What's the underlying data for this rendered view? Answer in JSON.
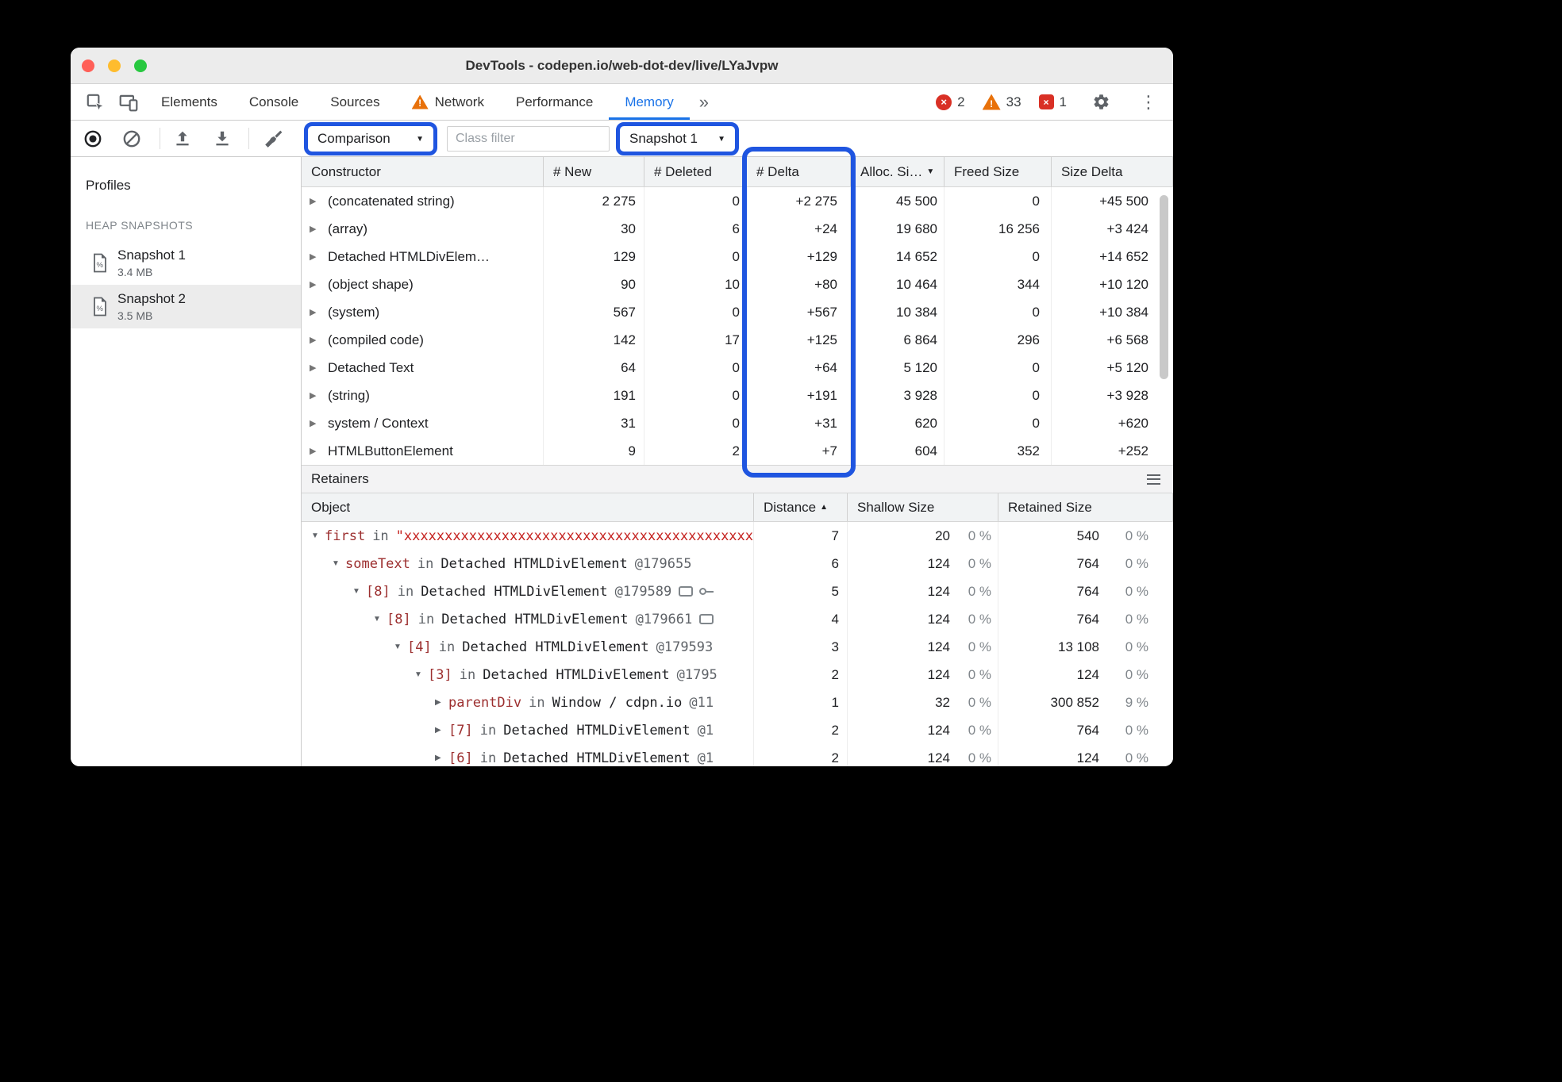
{
  "window": {
    "title": "DevTools - codepen.io/web-dot-dev/live/LYaJvpw"
  },
  "colors": {
    "accent_blue": "#1a73e8",
    "annotation_blue": "#1f55e0",
    "error_red": "#d93025",
    "warning_orange": "#e8710a",
    "retainer_key": "#9c2f2f",
    "retainer_string": "#c5221f"
  },
  "icons": {
    "expander_collapsed": "▶",
    "expander_expanded": "▼",
    "dropdown_arrow": "▼",
    "sort_desc": "▼",
    "sort_asc": "▲",
    "kebab": "⋮",
    "more_tabs": "»",
    "close_x": "×",
    "warning_mark": "!"
  },
  "tabbar": {
    "tabs": [
      {
        "label": "Elements"
      },
      {
        "label": "Console"
      },
      {
        "label": "Sources"
      },
      {
        "label": "Network"
      },
      {
        "label": "Performance"
      },
      {
        "label": "Memory"
      }
    ],
    "error_count": "2",
    "warning_count": "33",
    "issue_count": "1"
  },
  "toolbar": {
    "view_select": "Comparison",
    "filter_placeholder": "Class filter",
    "base_select": "Snapshot 1"
  },
  "sidebar": {
    "profiles_label": "Profiles",
    "section_label": "HEAP SNAPSHOTS",
    "snapshots": [
      {
        "name": "Snapshot 1",
        "size": "3.4 MB"
      },
      {
        "name": "Snapshot 2",
        "size": "3.5 MB"
      }
    ]
  },
  "heap": {
    "columns": {
      "constructor": "Constructor",
      "new": "# New",
      "deleted": "# Deleted",
      "delta": "# Delta",
      "alloc": "Alloc. Si…",
      "freed": "Freed Size",
      "size_delta": "Size Delta"
    },
    "rows": [
      {
        "name": "(concatenated string)",
        "new": "2 275",
        "deleted": "0",
        "delta": "+2 275",
        "alloc": "45 500",
        "freed": "0",
        "size_delta": "+45 500"
      },
      {
        "name": "(array)",
        "new": "30",
        "deleted": "6",
        "delta": "+24",
        "alloc": "19 680",
        "freed": "16 256",
        "size_delta": "+3 424"
      },
      {
        "name": "Detached HTMLDivElem…",
        "new": "129",
        "deleted": "0",
        "delta": "+129",
        "alloc": "14 652",
        "freed": "0",
        "size_delta": "+14 652"
      },
      {
        "name": "(object shape)",
        "new": "90",
        "deleted": "10",
        "delta": "+80",
        "alloc": "10 464",
        "freed": "344",
        "size_delta": "+10 120"
      },
      {
        "name": "(system)",
        "new": "567",
        "deleted": "0",
        "delta": "+567",
        "alloc": "10 384",
        "freed": "0",
        "size_delta": "+10 384"
      },
      {
        "name": "(compiled code)",
        "new": "142",
        "deleted": "17",
        "delta": "+125",
        "alloc": "6 864",
        "freed": "296",
        "size_delta": "+6 568"
      },
      {
        "name": "Detached Text",
        "new": "64",
        "deleted": "0",
        "delta": "+64",
        "alloc": "5 120",
        "freed": "0",
        "size_delta": "+5 120"
      },
      {
        "name": "(string)",
        "new": "191",
        "deleted": "0",
        "delta": "+191",
        "alloc": "3 928",
        "freed": "0",
        "size_delta": "+3 928"
      },
      {
        "name": "system / Context",
        "new": "31",
        "deleted": "0",
        "delta": "+31",
        "alloc": "620",
        "freed": "0",
        "size_delta": "+620"
      },
      {
        "name": "HTMLButtonElement",
        "new": "9",
        "deleted": "2",
        "delta": "+7",
        "alloc": "604",
        "freed": "352",
        "size_delta": "+252"
      }
    ]
  },
  "retainers": {
    "title": "Retainers",
    "columns": {
      "object": "Object",
      "distance": "Distance",
      "shallow": "Shallow Size",
      "retained": "Retained Size"
    },
    "rows": [
      {
        "arrow": "▼",
        "key": "first",
        "sep": "in",
        "str": "\"xxxxxxxxxxxxxxxxxxxxxxxxxxxxxxxxxxxxxxxxxxxxxx",
        "target": "",
        "addr": "",
        "distance": "7",
        "shallow": "20",
        "shallow_pct": "0 %",
        "retained": "540",
        "retained_pct": "0 %"
      },
      {
        "arrow": "▼",
        "key": "someText",
        "sep": "in",
        "str": "",
        "target": "Detached HTMLDivElement",
        "addr": "@179655",
        "distance": "6",
        "shallow": "124",
        "shallow_pct": "0 %",
        "retained": "764",
        "retained_pct": "0 %"
      },
      {
        "arrow": "▼",
        "key": "[8]",
        "sep": "in",
        "str": "",
        "target": "Detached HTMLDivElement",
        "addr": "@179589",
        "distance": "5",
        "shallow": "124",
        "shallow_pct": "0 %",
        "retained": "764",
        "retained_pct": "0 %"
      },
      {
        "arrow": "▼",
        "key": "[8]",
        "sep": "in",
        "str": "",
        "target": "Detached HTMLDivElement",
        "addr": "@179661",
        "distance": "4",
        "shallow": "124",
        "shallow_pct": "0 %",
        "retained": "764",
        "retained_pct": "0 %"
      },
      {
        "arrow": "▼",
        "key": "[4]",
        "sep": "in",
        "str": "",
        "target": "Detached HTMLDivElement",
        "addr": "@179593",
        "distance": "3",
        "shallow": "124",
        "shallow_pct": "0 %",
        "retained": "13 108",
        "retained_pct": "0 %"
      },
      {
        "arrow": "▼",
        "key": "[3]",
        "sep": "in",
        "str": "",
        "target": "Detached HTMLDivElement",
        "addr": "@1795",
        "distance": "2",
        "shallow": "124",
        "shallow_pct": "0 %",
        "retained": "124",
        "retained_pct": "0 %"
      },
      {
        "arrow": "▶",
        "key": "parentDiv",
        "sep": "in",
        "str": "",
        "target": "Window / cdpn.io",
        "addr": "@11",
        "distance": "1",
        "shallow": "32",
        "shallow_pct": "0 %",
        "retained": "300 852",
        "retained_pct": "9 %"
      },
      {
        "arrow": "▶",
        "key": "[7]",
        "sep": "in",
        "str": "",
        "target": "Detached HTMLDivElement",
        "addr": "@1",
        "distance": "2",
        "shallow": "124",
        "shallow_pct": "0 %",
        "retained": "764",
        "retained_pct": "0 %"
      },
      {
        "arrow": "▶",
        "key": "[6]",
        "sep": "in",
        "str": "",
        "target": "Detached HTMLDivElement",
        "addr": "@1",
        "distance": "2",
        "shallow": "124",
        "shallow_pct": "0 %",
        "retained": "124",
        "retained_pct": "0 %"
      }
    ]
  }
}
